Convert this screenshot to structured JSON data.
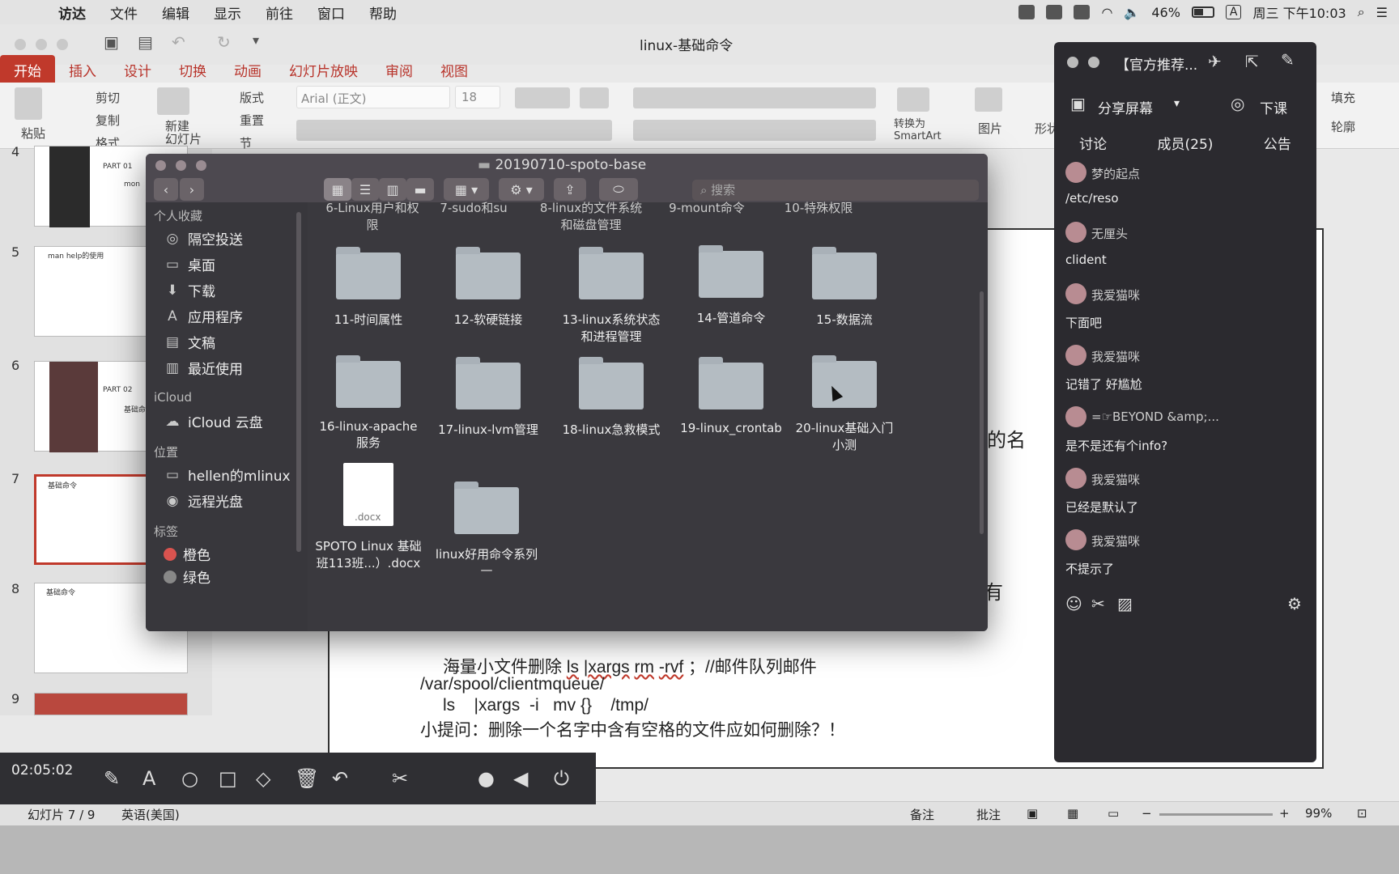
{
  "menubar": {
    "app": "访达",
    "items": [
      "文件",
      "编辑",
      "显示",
      "前往",
      "窗口",
      "帮助"
    ],
    "battery": "46%",
    "input_method": "A",
    "clock": "周三 下午10:03"
  },
  "ppt": {
    "title": "linux-基础命令",
    "tabs": [
      "开始",
      "插入",
      "设计",
      "切换",
      "动画",
      "幻灯片放映",
      "审阅",
      "视图"
    ],
    "ribbon": {
      "paste": "粘贴",
      "cut": "剪切",
      "copy": "复制",
      "format": "格式",
      "new_slide": "新建\n幻灯片",
      "layout": "版式",
      "reset": "重置",
      "section": "节",
      "font": "Arial (正文)",
      "font_size": "18",
      "convert_smartart": "转换为\nSmartArt",
      "picture": "图片",
      "shape": "形状",
      "fill": "填充",
      "outline": "轮廓"
    },
    "thumbs": [
      {
        "num": "4",
        "title": "PART 01",
        "sub": "mon"
      },
      {
        "num": "5",
        "title": "man help的使用"
      },
      {
        "num": "6",
        "title": "PART 02",
        "sub": "基础命"
      },
      {
        "num": "7",
        "title": "基础命令"
      },
      {
        "num": "8",
        "title": "基础命令"
      },
      {
        "num": "9"
      }
    ],
    "slide_lines": {
      "frag1": "的名",
      "frag2": "有",
      "line1a": "海量小文件删除",
      "line1b": "ls",
      "line1c": "|xargs",
      "line1d": "rm",
      "line1e": "-rvf",
      "line1f": "；//邮件队列邮件",
      "line2": "/var/spool/clientmqueue/",
      "line3": "ls    |xargs  -i   mv {}    /tmp/",
      "line4": "小提问：删除一个名字中含有空格的文件应如何删除？！"
    },
    "status": {
      "slide": "幻灯片 7 / 9",
      "lang": "英语(美国)",
      "notes": "备注",
      "comments": "批注",
      "zoom": "99%"
    }
  },
  "recorder": {
    "time": "02:05:02"
  },
  "finder": {
    "title": "20190710-spoto-base",
    "search_placeholder": "搜索",
    "sidebar": {
      "favorites_header": "个人收藏",
      "favorites": [
        "隔空投送",
        "桌面",
        "下载",
        "应用程序",
        "文稿",
        "最近使用"
      ],
      "icloud_header": "iCloud",
      "icloud": [
        "iCloud 云盘"
      ],
      "locations_header": "位置",
      "locations": [
        "hellen的mlinux",
        "远程光盘"
      ],
      "tags_header": "标签",
      "tags": [
        "橙色",
        "绿色"
      ]
    },
    "items_top": [
      "6-Linux用户和权\n限",
      "7-sudo和su",
      "8-linux的文件系统\n和磁盘管理",
      "9-mount命令",
      "10-特殊权限"
    ],
    "row1": [
      "11-时间属性",
      "12-软硬链接",
      "13-linux系统状态\n和进程管理",
      "14-管道命令",
      "15-数据流"
    ],
    "row2": [
      "16-linux-apache\n服务",
      "17-linux-lvm管理",
      "18-linux急救模式",
      "19-linux_crontab",
      "20-linux基础入门\n小测"
    ],
    "row3": [
      {
        "name": "SPOTO Linux 基础\n班113班...）.docx",
        "kind": "docx",
        "badge": ".docx"
      },
      {
        "name": "linux好用命令系列\n—",
        "kind": "folder"
      }
    ]
  },
  "chat": {
    "title": "【官方推荐...",
    "share": "分享屏幕",
    "end": "下课",
    "tabs": [
      "讨论",
      "成员(25)",
      "公告"
    ],
    "messages": [
      {
        "name": "梦的起点",
        "text": "/etc/reso"
      },
      {
        "name": "无厘头",
        "text": "clident"
      },
      {
        "name": "我爱猫咪",
        "text": "下面吧"
      },
      {
        "name": "我爱猫咪",
        "text": "记错了 好尴尬"
      },
      {
        "name": "=☞BEYOND &amp;...",
        "text": "是不是还有个info?"
      },
      {
        "name": "我爱猫咪",
        "text": "已经是默认了"
      },
      {
        "name": "我爱猫咪",
        "text": "不提示了"
      }
    ]
  }
}
